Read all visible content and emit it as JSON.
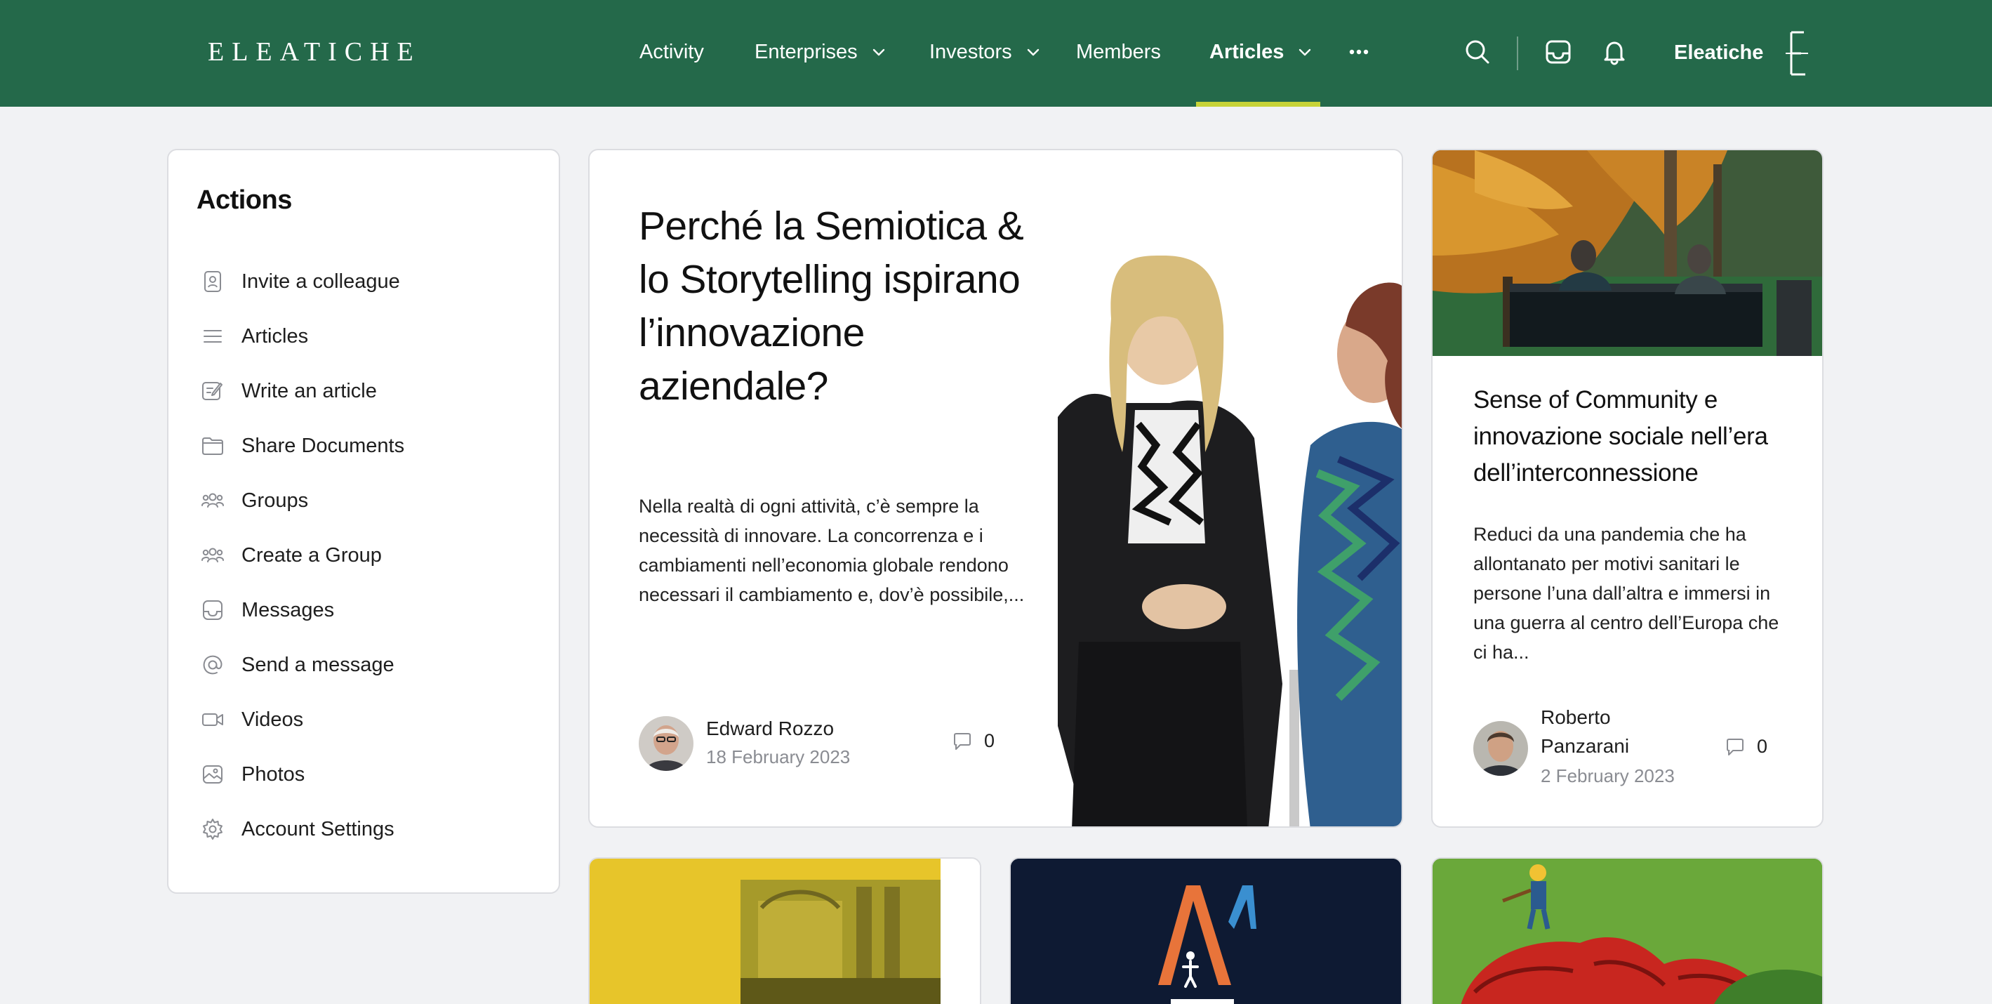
{
  "header": {
    "logo": "ELEATICHE",
    "nav": [
      {
        "label": "Activity"
      },
      {
        "label": "Enterprises"
      },
      {
        "label": "Investors"
      },
      {
        "label": "Members"
      },
      {
        "label": "Articles"
      }
    ],
    "active_nav": "Articles",
    "user_name": "Eleatiche",
    "icons": [
      "search-icon",
      "inbox-icon",
      "bell-icon",
      "more-icon",
      "chevron-down-icon"
    ],
    "accent_color": "#c7d337",
    "brand_color": "#24694a"
  },
  "actions": {
    "title": "Actions",
    "items": [
      {
        "label": "Invite a colleague",
        "icon": "contact-card-icon"
      },
      {
        "label": "Articles",
        "icon": "list-icon"
      },
      {
        "label": "Write an article",
        "icon": "edit-icon"
      },
      {
        "label": "Share Documents",
        "icon": "folder-icon"
      },
      {
        "label": "Groups",
        "icon": "users-icon"
      },
      {
        "label": "Create a Group",
        "icon": "users-icon"
      },
      {
        "label": "Messages",
        "icon": "inbox-icon"
      },
      {
        "label": "Send a message",
        "icon": "at-icon"
      },
      {
        "label": "Videos",
        "icon": "video-icon"
      },
      {
        "label": "Photos",
        "icon": "photo-icon"
      },
      {
        "label": "Account Settings",
        "icon": "gear-icon"
      }
    ]
  },
  "featured": {
    "title": "Perché la Semiotica & lo Storytelling ispirano l’innovazione aziendale?",
    "excerpt": "Nella realtà di ogni attività, c’è sempre la necessità di innovare. La concorrenza e i cambiamenti nell’economia globale rendono necessari il cambiamento e, dov’è possibile,...",
    "author": "Edward Rozzo",
    "date": "18 February 2023",
    "comments": "0"
  },
  "side": {
    "title": "Sense of Community e innovazione sociale nell’era dell’interconnessione",
    "excerpt": "Reduci da una pandemia che ha allontanato per motivi sanitari le persone l’una dall’altra e immersi in una guerra al centro dell’Europa che ci ha...",
    "author_line1": "Roberto",
    "author_line2": "Panzarani",
    "date": "2 February 2023",
    "comments": "0"
  }
}
